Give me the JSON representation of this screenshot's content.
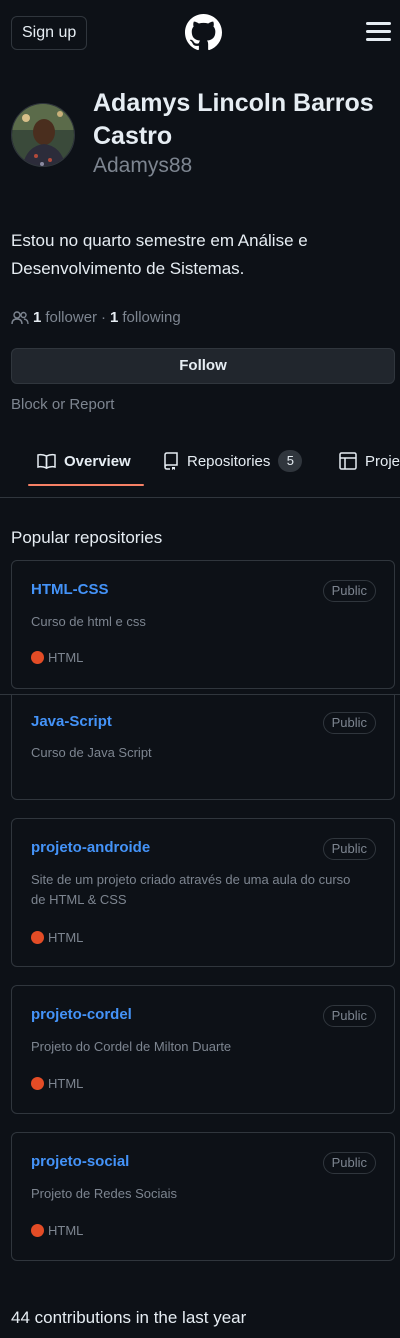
{
  "header": {
    "signup_label": "Sign up"
  },
  "profile": {
    "full_name": "Adamys Lincoln Barros Castro",
    "username": "Adamys88",
    "bio": "Estou no quarto semestre em Análise e Desenvolvimento de Sistemas.",
    "followers_count": "1",
    "followers_label": "follower",
    "separator": "·",
    "following_count": "1",
    "following_label": "following",
    "follow_button": "Follow",
    "block_report": "Block or Report"
  },
  "tabs": [
    {
      "label": "Overview",
      "icon": "book-icon"
    },
    {
      "label": "Repositories",
      "icon": "repo-icon",
      "count": "5"
    },
    {
      "label": "Projects",
      "icon": "table-icon"
    }
  ],
  "popular": {
    "title": "Popular repositories",
    "repos": [
      {
        "name": "HTML-CSS",
        "visibility": "Public",
        "description": "Curso de html e css",
        "language": "HTML"
      },
      {
        "name": "Java-Script",
        "visibility": "Public",
        "description": "Curso de Java Script",
        "language": ""
      },
      {
        "name": "projeto-androide",
        "visibility": "Public",
        "description": "Site de um projeto criado através de uma aula do curso de HTML & CSS",
        "language": "HTML"
      },
      {
        "name": "projeto-cordel",
        "visibility": "Public",
        "description": "Projeto do Cordel de Milton Duarte",
        "language": "HTML"
      },
      {
        "name": "projeto-social",
        "visibility": "Public",
        "description": "Projeto de Redes Sociais",
        "language": "HTML"
      }
    ]
  },
  "contributions": "44 contributions in the last year",
  "colors": {
    "link": "#4493f8",
    "html_lang": "#e34c26",
    "tab_underline": "#f78166",
    "bg": "#0d1117"
  }
}
